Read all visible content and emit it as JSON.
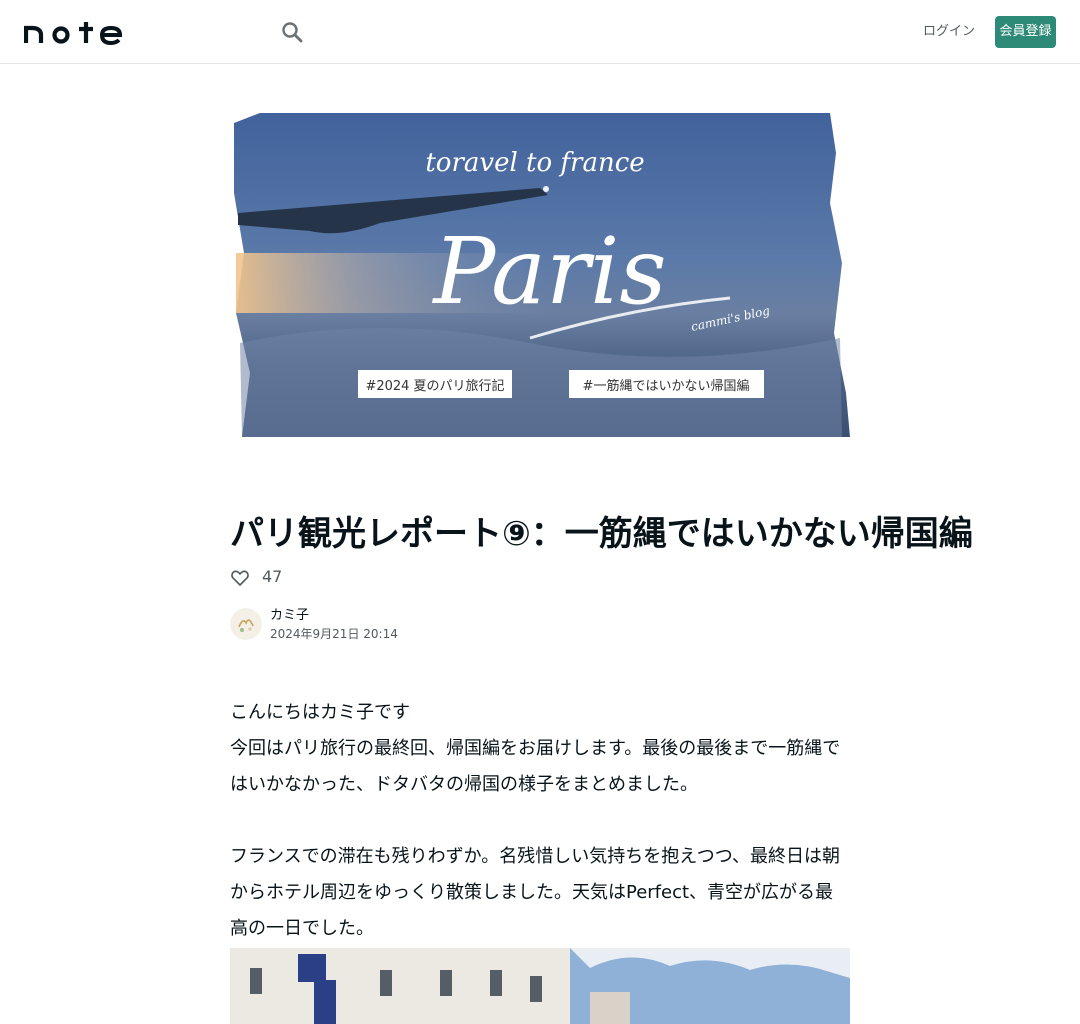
{
  "header": {
    "logo_text": "note",
    "login_label": "ログイン",
    "signup_label": "会員登録"
  },
  "hero": {
    "script_top": "toravel to france",
    "script_main": "Paris",
    "signature": "cammi's blog",
    "tag_left": "#2024 夏のパリ旅行記",
    "tag_right": "#一筋縄ではいかない帰国編"
  },
  "article": {
    "title": "パリ観光レポート⑨：一筋縄ではいかない帰国編",
    "like_count": "47",
    "author": "カミ子",
    "date": "2024年9月21日 20:14",
    "paragraphs": [
      "こんにちはカミ子です",
      "今回はパリ旅行の最終回、帰国編をお届けします。最後の最後まで一筋縄ではいかなかった、ドタバタの帰国の様子をまとめました。",
      "フランスでの滞在も残りわずか。名残惜しい気持ちを抱えつつ、最終日は朝からホテル周辺をゆっくり散策しました。天気はPerfect、青空が広がる最高の一日でした。"
    ]
  },
  "colors": {
    "accent": "#2d8a76",
    "text": "#08131a",
    "muted": "#525a5f"
  }
}
